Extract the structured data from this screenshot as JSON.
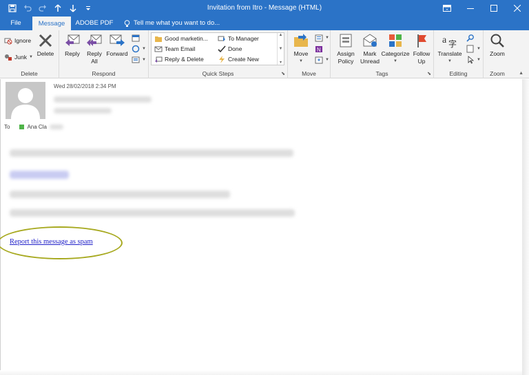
{
  "window": {
    "title": "Invitation from Itro  -  Message (HTML)",
    "accent_color": "#2b73c7"
  },
  "qat": {
    "icons": [
      "save-icon",
      "undo-icon",
      "redo-icon",
      "up-icon",
      "down-icon",
      "customize-icon"
    ]
  },
  "tabs": [
    {
      "label": "File",
      "active": false
    },
    {
      "label": "Message",
      "active": true
    },
    {
      "label": "ADOBE PDF",
      "active": false
    }
  ],
  "tell_me": {
    "label": "Tell me what you want to do..."
  },
  "ribbon": {
    "delete_group": {
      "label": "Delete",
      "ignore": "Ignore",
      "junk": "Junk",
      "delete": "Delete"
    },
    "respond_group": {
      "label": "Respond",
      "reply": "Reply",
      "reply_all_line1": "Reply",
      "reply_all_line2": "All",
      "forward": "Forward"
    },
    "quick_steps_group": {
      "label": "Quick Steps",
      "items": [
        "Good marketin...",
        "Team Email",
        "Reply & Delete",
        "To Manager",
        "Done",
        "Create New"
      ]
    },
    "move_group": {
      "label": "Move",
      "move": "Move"
    },
    "tags_group": {
      "label": "Tags",
      "assign_line1": "Assign",
      "assign_line2": "Policy",
      "mark_line1": "Mark",
      "mark_line2": "Unread",
      "categorize": "Categorize",
      "follow_line1": "Follow",
      "follow_line2": "Up"
    },
    "editing_group": {
      "label": "Editing",
      "translate": "Translate"
    },
    "zoom_group": {
      "label": "Zoom",
      "zoom": "Zoom"
    }
  },
  "message": {
    "date": "Wed 28/02/2018 2:34 PM",
    "to_label": "To",
    "to_name": "Ana Cla",
    "spam_link": "Report this message as spam",
    "highlight_color": "#a7a91f"
  }
}
